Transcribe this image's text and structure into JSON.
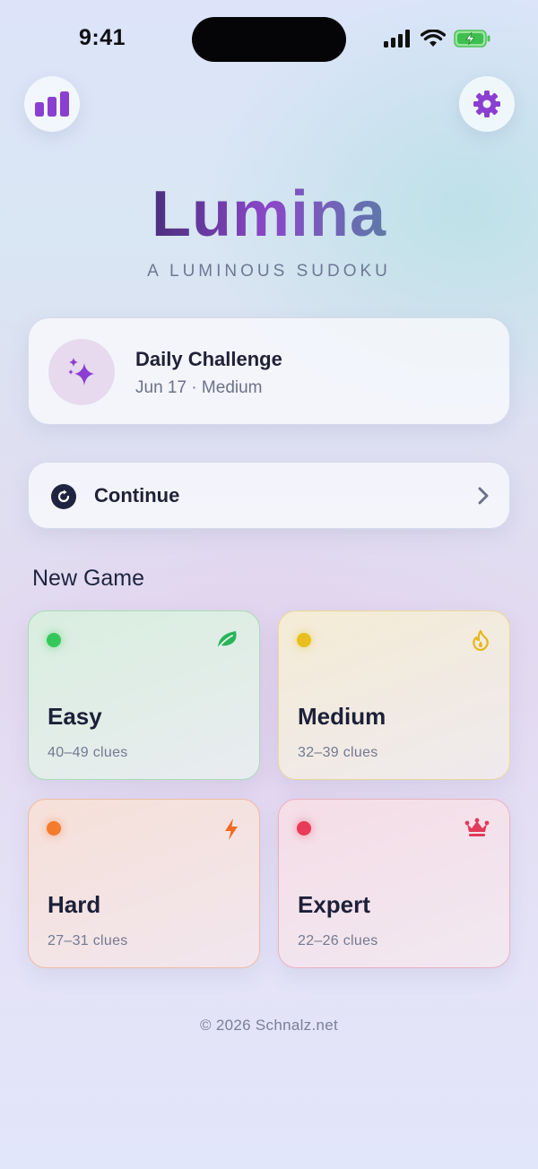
{
  "status_bar": {
    "time": "9:41"
  },
  "app": {
    "title": "Lumina",
    "tagline": "A LUMINOUS SUDOKU"
  },
  "top_bar": {
    "left_icon": "stats-icon",
    "right_icon": "gear-icon"
  },
  "daily": {
    "title": "Daily Challenge",
    "subtitle": "Jun 17 · Medium",
    "icon": "sparkle-icon"
  },
  "continue": {
    "label": "Continue",
    "icon": "resume-icon"
  },
  "new_game": {
    "title": "New Game",
    "levels": [
      {
        "name": "Easy",
        "clues": "40–49 clues",
        "color": "#34c759",
        "icon": "leaf-icon"
      },
      {
        "name": "Medium",
        "clues": "32–39 clues",
        "color": "#e8bf1e",
        "icon": "flame-icon"
      },
      {
        "name": "Hard",
        "clues": "27–31 clues",
        "color": "#f47a2d",
        "icon": "bolt-icon"
      },
      {
        "name": "Expert",
        "clues": "22–26 clues",
        "color": "#e83a5b",
        "icon": "crown-icon"
      }
    ]
  },
  "colors": {
    "accent": "#8b3fd0",
    "text_dark": "#1c2038"
  },
  "footer": "© 2026 Schnalz.net"
}
